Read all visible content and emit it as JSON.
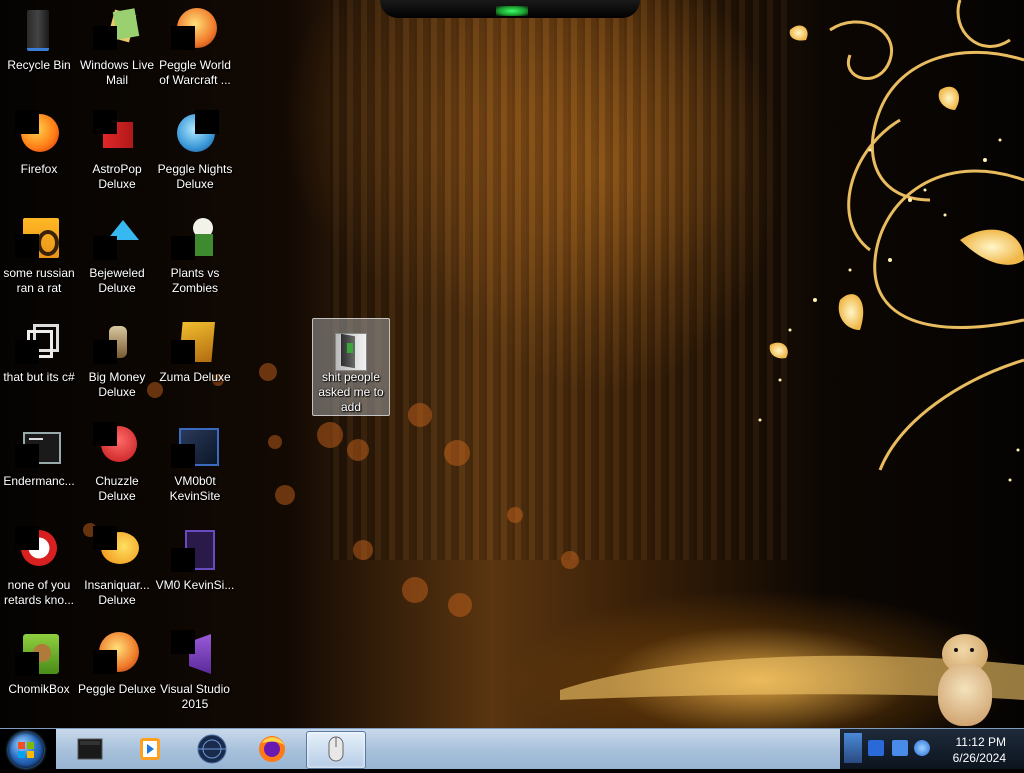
{
  "desktop": {
    "icons": [
      {
        "label": "Recycle Bin"
      },
      {
        "label": "Windows Live Mail"
      },
      {
        "label": "Peggle World of Warcraft ..."
      },
      {
        "label": "Firefox"
      },
      {
        "label": "AstroPop Deluxe"
      },
      {
        "label": "Peggle Nights Deluxe"
      },
      {
        "label": "some russian ran a rat"
      },
      {
        "label": "Bejeweled Deluxe"
      },
      {
        "label": "Plants vs Zombies"
      },
      {
        "label": "that but its c#"
      },
      {
        "label": "Big Money Deluxe"
      },
      {
        "label": "Zuma Deluxe"
      },
      {
        "label": "Endermanc..."
      },
      {
        "label": "Chuzzle Deluxe"
      },
      {
        "label": "VM0b0t KevinSite"
      },
      {
        "label": "none of you retards kno..."
      },
      {
        "label": "Insaniquar... Deluxe"
      },
      {
        "label": "VM0 KevinSi..."
      },
      {
        "label": "ChomikBox"
      },
      {
        "label": "Peggle Deluxe"
      },
      {
        "label": "Visual Studio 2015"
      }
    ],
    "folder": {
      "label": "shit people asked me to add"
    }
  },
  "taskbar": {
    "pinned": [
      {
        "icon": "terminal-icon"
      },
      {
        "icon": "media-player-icon"
      },
      {
        "icon": "globe-icon"
      },
      {
        "icon": "firefox-icon"
      },
      {
        "icon": "mouse-icon"
      }
    ],
    "clock": {
      "time": "11:12 PM",
      "date": "6/26/2024"
    }
  },
  "colors": {
    "taskbar": "#a9c2dc",
    "accent": "#2b6fc4",
    "wallpaper_glow": "#e6a844"
  }
}
